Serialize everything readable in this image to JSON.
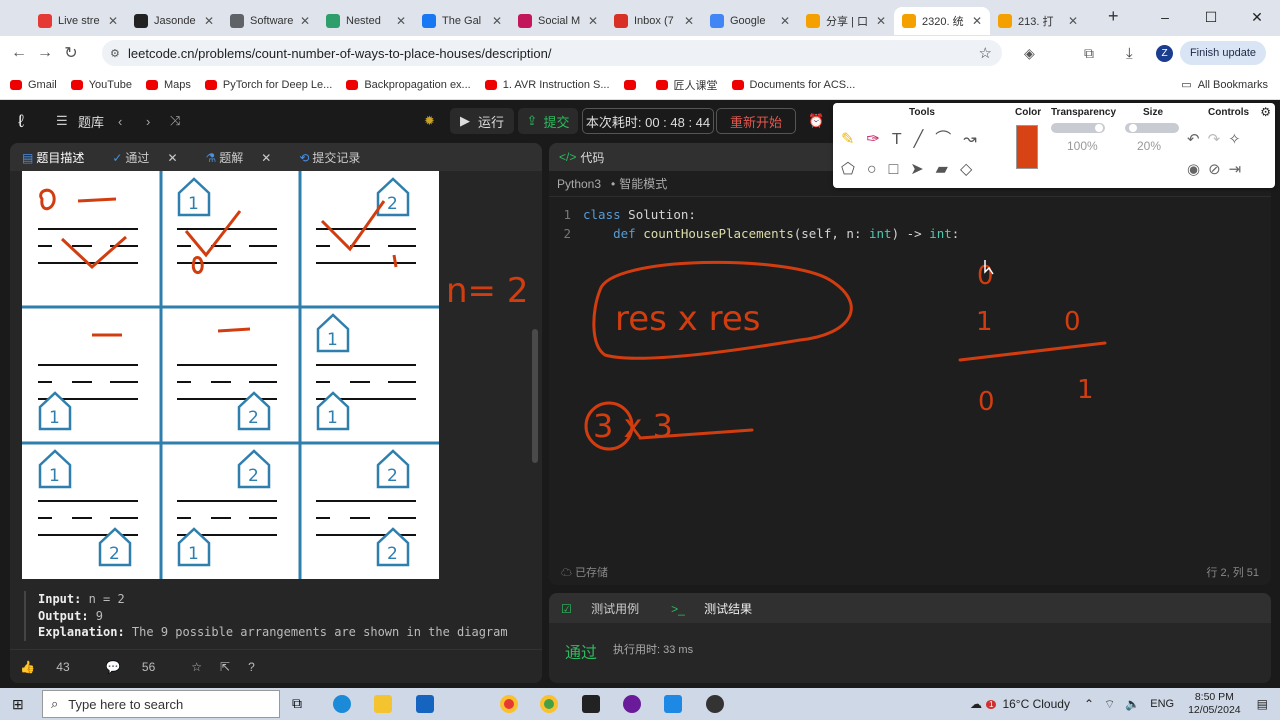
{
  "browser": {
    "tabs": [
      {
        "title": "Live stre",
        "color": "#e53935"
      },
      {
        "title": "Jasonde",
        "color": "#222222"
      },
      {
        "title": "Software",
        "color": "#5f6368"
      },
      {
        "title": "Nested",
        "color": "#2e9e6b"
      },
      {
        "title": "The Gal",
        "color": "#1877f2"
      },
      {
        "title": "Social M",
        "color": "#c2185b"
      },
      {
        "title": "Inbox (7",
        "color": "#d93025"
      },
      {
        "title": "Google",
        "color": "#4285f4"
      },
      {
        "title": "分享 | 口",
        "color": "#f4a100"
      },
      {
        "title": "2320. 统",
        "color": "#f4a100",
        "active": true
      },
      {
        "title": "213. 打",
        "color": "#f4a100"
      }
    ],
    "url": "leetcode.cn/problems/count-number-of-ways-to-place-houses/description/",
    "finish_update": "Finish update",
    "profile": "Z",
    "bookmarks": [
      "Gmail",
      "YouTube",
      "Maps",
      "PyTorch for Deep Le...",
      "Backpropagation ex...",
      "1. AVR Instruction S...",
      "",
      "匠人课堂",
      "Documents for ACS..."
    ],
    "all_bookmarks": "All Bookmarks"
  },
  "leetcode": {
    "problem_list": "题库",
    "run": "运行",
    "submit": "提交",
    "timer_label": "本次耗时: 00 : 48 : 44",
    "restart": "重新开始",
    "left_tabs": [
      "题目描述",
      "通过",
      "题解",
      "提交记录"
    ],
    "example": {
      "input_label": "Input:",
      "input_value": " n = 2",
      "output_label": "Output:",
      "output_value": " 9",
      "explanation_label": "Explanation:",
      "explanation_value": " The 9 possible arrangements are shown in the diagram"
    },
    "likes": "43",
    "comments": "56",
    "code_tab": "代码",
    "language": "Python3",
    "mode": "智能模式",
    "code_lines": [
      {
        "num": "1",
        "indent": "",
        "kw": "class",
        "rest": " Solution:"
      },
      {
        "num": "2",
        "indent": "    ",
        "kw": "def",
        "fn": " countHousePlacements",
        "args": "(self, n: ",
        "ty": "int",
        "after": ") -> ",
        "ret": "int",
        "end": ":"
      }
    ],
    "saved": "已存储",
    "cursor_pos": "行 2, 列 51",
    "result_tabs": [
      "测试用例",
      "测试结果"
    ],
    "result_status": "通过",
    "runtime": "执行用时: 33 ms"
  },
  "annotations": {
    "n_eq": "n= 2",
    "res": "res x res",
    "three": "3 x 3",
    "table_top": "0",
    "table_left": "1",
    "table_right": "0",
    "table_bl": "0",
    "table_br": "1"
  },
  "toolbox": {
    "tools": "Tools",
    "color": "Color",
    "transparency": "Transparency",
    "transparency_value": "100%",
    "size": "Size",
    "size_value": "20%",
    "controls": "Controls",
    "current_color": "#d84315"
  },
  "taskbar": {
    "search_placeholder": "Type here to search",
    "weather": "16°C  Cloudy",
    "lang": "ENG",
    "time": "8:50 PM",
    "date": "12/05/2024",
    "notif_badge": "1"
  }
}
